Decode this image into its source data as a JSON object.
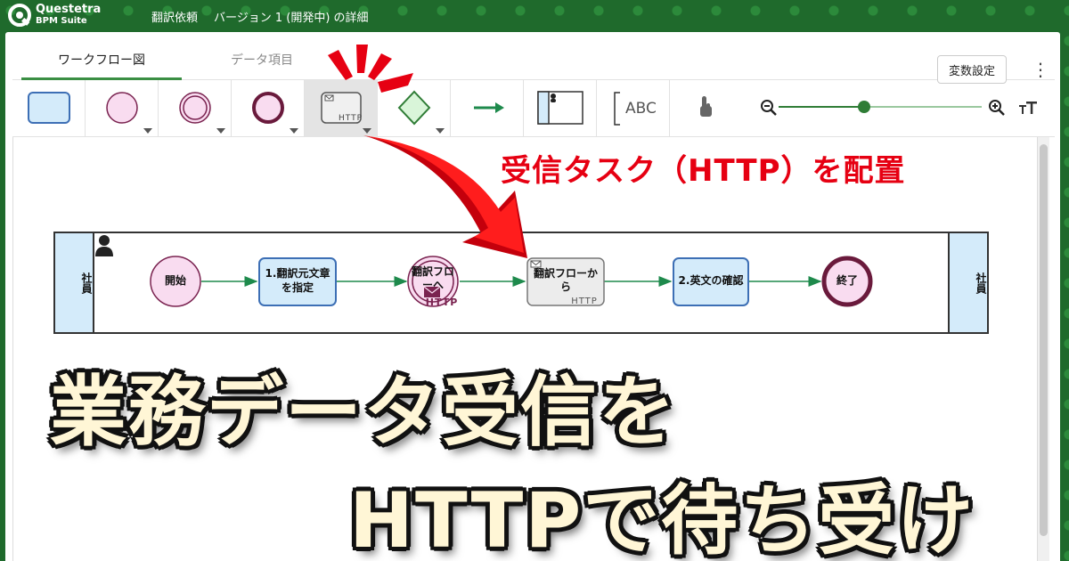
{
  "app": {
    "brand_line1": "Questetra",
    "brand_line2": "BPM Suite"
  },
  "breadcrumb": {
    "item1": "翻訳依頼",
    "item2": "バージョン 1 (開発中) の詳細"
  },
  "tabs": [
    {
      "label": "ワークフロー図",
      "active": true
    },
    {
      "label": "データ項目",
      "active": false
    }
  ],
  "toolbar": {
    "variables_button": "変数設定",
    "menu_icon": "kebab-icon"
  },
  "palette": {
    "http_task_caption": "HTTP",
    "text_tool_caption": "ABC",
    "zoom_level": 0.42
  },
  "lane": {
    "label_left": "社員",
    "label_right": "社員"
  },
  "nodes": {
    "start": "開始",
    "task1_line1": "1.翻訳元文章",
    "task1_line2": "を指定",
    "send_line1": "翻訳フロ",
    "send_line2": "ーへ",
    "send_caption": "HTTP",
    "receive_line1": "翻訳フローか",
    "receive_line2": "ら",
    "receive_caption": "HTTP",
    "task2": "2.英文の確認",
    "end": "終了"
  },
  "overlay": {
    "callout": "受信タスク（HTTP）を配置",
    "headline_line1": "業務データ受信を",
    "headline_line2": "HTTPで待ち受け"
  },
  "colors": {
    "header_green": "#1f6a2c",
    "accent_green": "#2f7d36",
    "flow_green": "#1e8a4c",
    "callout_red": "#e60012",
    "task_fill": "#d4ebfa",
    "task_stroke": "#3d6fb5",
    "event_fill": "#f9dcf0",
    "event_stroke": "#7a2350"
  }
}
